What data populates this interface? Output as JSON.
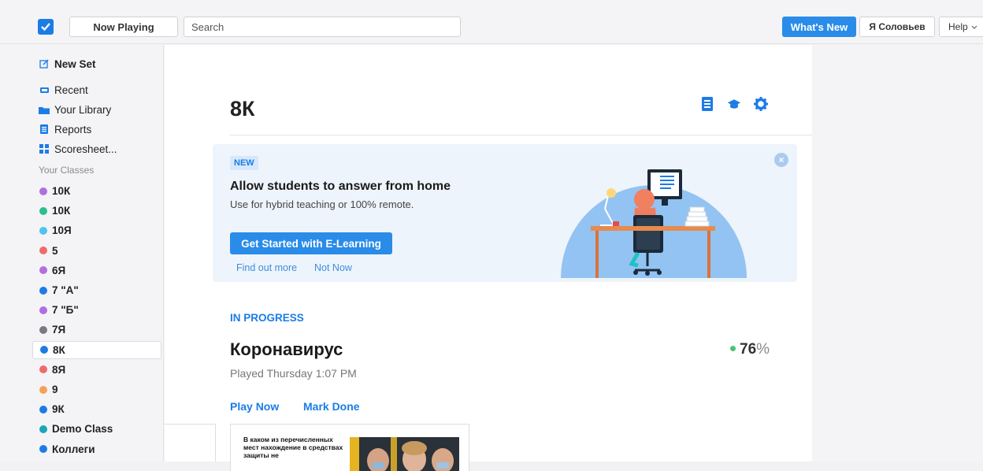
{
  "topbar": {
    "now_playing": "Now Playing",
    "search_placeholder": "Search",
    "whats_new": "What's New",
    "user": "Я Соловьев",
    "help": "Help"
  },
  "sidebar": {
    "new_set": "New Set",
    "recent": "Recent",
    "library": "Your Library",
    "reports": "Reports",
    "scoresheet": "Scoresheet...",
    "classes_heading": "Your Classes",
    "classes": [
      {
        "name": "10К",
        "color": "#b06fe0"
      },
      {
        "name": "10К",
        "color": "#2bbf8c"
      },
      {
        "name": "10Я",
        "color": "#4fc3f0"
      },
      {
        "name": "5",
        "color": "#ef6b6b"
      },
      {
        "name": "6Я",
        "color": "#b06fe0"
      },
      {
        "name": "7 \"А\"",
        "color": "#1c7ce6"
      },
      {
        "name": "7 \"Б\"",
        "color": "#b06fe0"
      },
      {
        "name": "7Я",
        "color": "#7a7a80"
      },
      {
        "name": "8К",
        "color": "#1c7ce6"
      },
      {
        "name": "8Я",
        "color": "#ef6b6b"
      },
      {
        "name": "9",
        "color": "#f5a05a"
      },
      {
        "name": "9К",
        "color": "#1c7ce6"
      },
      {
        "name": "Demo Class",
        "color": "#1aa6b7"
      },
      {
        "name": "Коллеги",
        "color": "#1c7ce6"
      }
    ]
  },
  "main": {
    "title": "8К",
    "banner": {
      "badge": "NEW",
      "title": "Allow students to answer from home",
      "subtitle": "Use for hybrid teaching or 100% remote.",
      "cta": "Get Started with E-Learning",
      "find_out": "Find out more",
      "not_now": "Not Now"
    },
    "in_progress_label": "IN PROGRESS",
    "game": {
      "title": "Коронавирус",
      "score": "76",
      "score_unit": "%",
      "played": "Played Thursday 1:07 PM",
      "play_now": "Play Now",
      "mark_done": "Mark Done",
      "thumb_text": "В каком из перечисленных мест нахождение в средствах защиты не"
    }
  },
  "colors": {
    "accent": "#1c7ce6",
    "score_dot": "#4cc17a"
  }
}
